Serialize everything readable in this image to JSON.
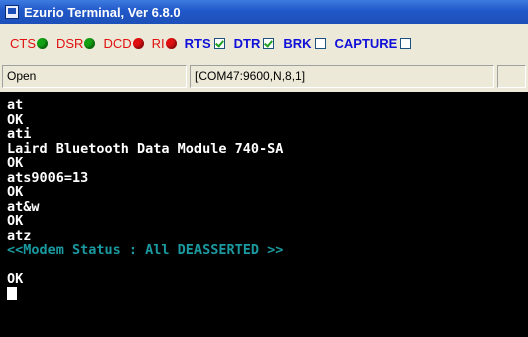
{
  "window": {
    "title": "Ezurio Terminal, Ver 6.8.0"
  },
  "signals": [
    {
      "label": "CTS",
      "led_color": "#13a013"
    },
    {
      "label": "DSR",
      "led_color": "#13a013"
    },
    {
      "label": "DCD",
      "led_color": "#e01010"
    },
    {
      "label": "RI",
      "led_color": "#e01010"
    }
  ],
  "toggles": [
    {
      "label": "RTS",
      "checked": true
    },
    {
      "label": "DTR",
      "checked": true
    },
    {
      "label": "BRK",
      "checked": false
    },
    {
      "label": "CAPTURE",
      "checked": false
    }
  ],
  "colors": {
    "signal_label": "#e01010",
    "toggle_label": "#1010d8",
    "terminal_status": "#1a9aa0"
  },
  "status": {
    "open_label": "Open",
    "port_info": "[COM47:9600,N,8,1]"
  },
  "terminal": {
    "lines": [
      {
        "text": "at"
      },
      {
        "text": "OK"
      },
      {
        "text": "ati"
      },
      {
        "text": "Laird Bluetooth Data Module 740-SA"
      },
      {
        "text": "OK"
      },
      {
        "text": "ats9006=13"
      },
      {
        "text": "OK"
      },
      {
        "text": "at&w"
      },
      {
        "text": "OK"
      },
      {
        "text": "atz"
      },
      {
        "text": "<<Modem Status : All DEASSERTED >>",
        "kind": "status"
      },
      {
        "text": ""
      },
      {
        "text": "OK"
      }
    ]
  }
}
